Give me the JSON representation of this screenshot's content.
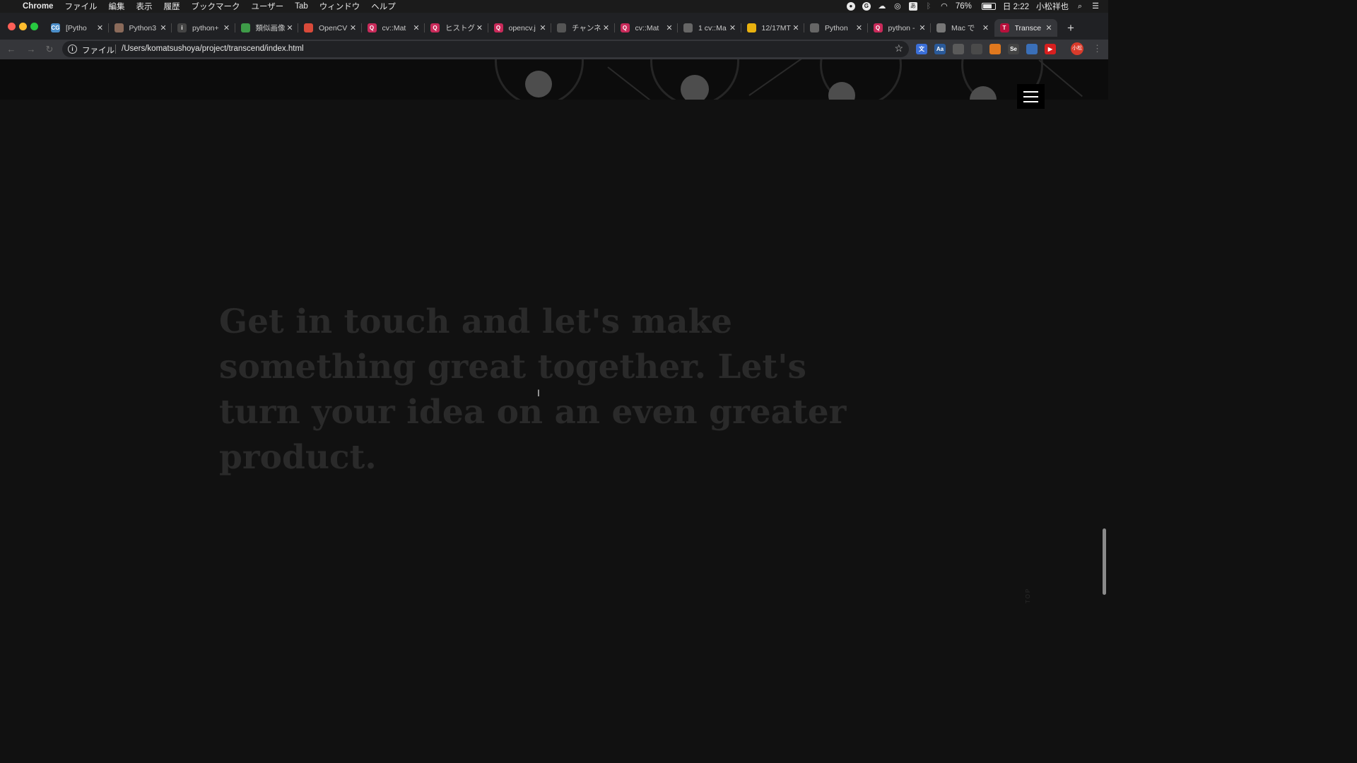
{
  "menubar": {
    "apple": "",
    "app_name": "Chrome",
    "items": [
      "ファイル",
      "編集",
      "表示",
      "履歴",
      "ブックマーク",
      "ユーザー",
      "Tab",
      "ウィンドウ",
      "ヘルプ"
    ],
    "battery_percent": "76%",
    "clock": "日 2:22",
    "user": "小松祥也",
    "status_icons": [
      "record-icon",
      "grammarly-icon",
      "cloud-icon",
      "creative-cloud-icon",
      "input-method-icon",
      "bluetooth-icon",
      "wifi-icon"
    ],
    "input_method_label": "あ",
    "wifi_glyph": "◠",
    "search_glyph": "⌕",
    "list_glyph": "☰"
  },
  "tabs": [
    {
      "title": "[Pytho",
      "favicon": "cg-icon",
      "fav_label": "CG",
      "fav_color": "#4b8ec9"
    },
    {
      "title": "Python3",
      "favicon": "avatar-icon",
      "fav_label": "",
      "fav_color": "#8a6a5a"
    },
    {
      "title": "python+",
      "favicon": "info-circle-icon",
      "fav_label": "i",
      "fav_color": "#444444"
    },
    {
      "title": "類似画像",
      "favicon": "leaf-icon",
      "fav_label": "",
      "fav_color": "#3e9b48"
    },
    {
      "title": "OpenCV",
      "favicon": "opencv-icon",
      "fav_label": "",
      "fav_color": "#d84a3a"
    },
    {
      "title": "cv::Mat",
      "favicon": "qiita-icon",
      "fav_label": "Q",
      "fav_color": "#c92a5a"
    },
    {
      "title": "ヒストグ",
      "favicon": "qiita-icon",
      "fav_label": "Q",
      "fav_color": "#c92a5a"
    },
    {
      "title": "opencv.j",
      "favicon": "qiita-icon",
      "fav_label": "Q",
      "fav_color": "#c92a5a"
    },
    {
      "title": "チャンネ",
      "favicon": "bird-icon",
      "fav_label": "",
      "fav_color": "#555555"
    },
    {
      "title": "cv::Mat",
      "favicon": "qiita-icon",
      "fav_label": "Q",
      "fav_color": "#c92a5a"
    },
    {
      "title": "1 cv::Ma",
      "favicon": "globe-icon",
      "fav_label": "",
      "fav_color": "#666666"
    },
    {
      "title": "12/17MT",
      "favicon": "slides-icon",
      "fav_label": "",
      "fav_color": "#e9b10f"
    },
    {
      "title": "Python",
      "favicon": "globe-icon",
      "fav_label": "",
      "fav_color": "#666666"
    },
    {
      "title": "python -",
      "favicon": "qiita-icon",
      "fav_label": "Q",
      "fav_color": "#c92a5a"
    },
    {
      "title": "Mac で",
      "favicon": "apple-icon",
      "fav_label": "",
      "fav_color": "#777777"
    },
    {
      "title": "Transce",
      "favicon": "transcend-icon",
      "fav_label": "T",
      "fav_color": "#b8103c",
      "active": true
    }
  ],
  "tab_close_glyph": "✕",
  "new_tab_glyph": "+",
  "toolbar": {
    "back_glyph": "←",
    "forward_glyph": "→",
    "reload_glyph": "↻",
    "info_glyph": "i",
    "url_scheme": "ファイル",
    "url": "/Users/komatsushoya/project/transcend/index.html",
    "star_glyph": "☆",
    "extensions": [
      {
        "name": "translate-ext-icon",
        "color": "#3b6fd8",
        "label": "文"
      },
      {
        "name": "dictionary-ext-icon",
        "color": "#2a5a9a",
        "label": "Aa"
      },
      {
        "name": "screen-capture-ext-icon",
        "color": "#5a5a5a",
        "label": ""
      },
      {
        "name": "qr-ext-icon",
        "color": "#4a4a4a",
        "label": ""
      },
      {
        "name": "metamask-ext-icon",
        "color": "#e0781e",
        "label": ""
      },
      {
        "name": "selenium-ext-icon",
        "color": "#444444",
        "label": "Se"
      },
      {
        "name": "react-devtools-ext-icon",
        "color": "#3a6fb8",
        "label": ""
      },
      {
        "name": "youtube-ext-icon",
        "color": "#d81f1f",
        "label": "▶"
      }
    ],
    "profile_label": "小松",
    "menu_glyph": "⋮"
  },
  "page": {
    "headline": "Get in touch and let's make something great together. Let's turn your idea on an even greater product.",
    "top_link": "TOP",
    "cursor_glyph": "I"
  },
  "colors": {
    "page_bg": "#111111",
    "headline": "#2a2a2a",
    "hamburger_bg": "#000000",
    "traffic_close": "#fe5f57",
    "traffic_min": "#febc2e",
    "traffic_max": "#28c840"
  }
}
